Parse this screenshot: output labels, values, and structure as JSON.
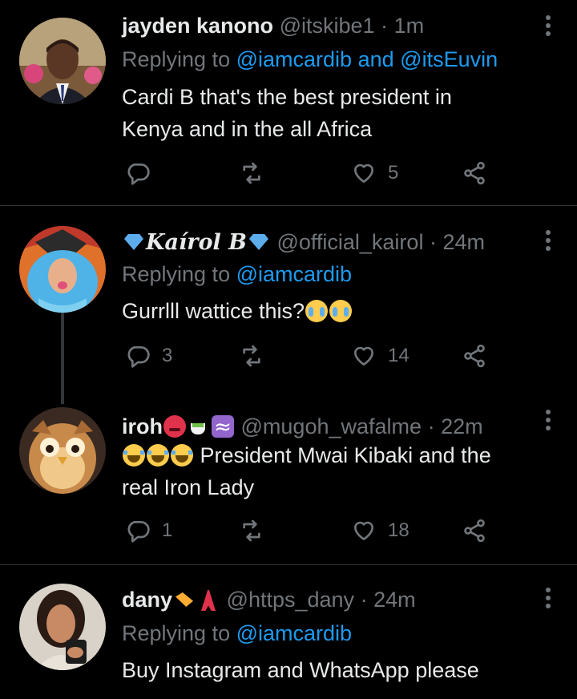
{
  "colors": {
    "background": "#000000",
    "primary_text": "#e7e9ea",
    "secondary_text": "#71767b",
    "accent": "#1d9bf0",
    "divider": "#2f3336"
  },
  "tweets": [
    {
      "name": "jayden kanono",
      "handle": "@itskibe1",
      "separator": "·",
      "time": "1m",
      "replying_prefix": "Replying to",
      "mention1": "@iamcardib",
      "mention_join": "and",
      "mention2": "@itsEuvin",
      "text_line1": "Cardi B that's the best president in",
      "text_line2": "Kenya and in the all Africa",
      "reply_count": "",
      "retweet_count": "",
      "like_count": "5",
      "avatar_icon": "avatar-man-suit"
    },
    {
      "name": "Kaírol B",
      "handle": "@official_kairol",
      "separator": "·",
      "time": "24m",
      "replying_prefix": "Replying to",
      "mention1": "@iamcardib",
      "text_line1": "Gurrlll wattice this?",
      "reply_count": "3",
      "retweet_count": "",
      "like_count": "14",
      "avatar_icon": "avatar-blue-hair"
    },
    {
      "name": "iroh",
      "handle": "@mugoh_wafalme",
      "separator": "·",
      "time": "22m",
      "text_line1_suffix": "President Mwai Kibaki and the",
      "text_line2": "real Iron Lady",
      "reply_count": "1",
      "retweet_count": "",
      "like_count": "18",
      "avatar_icon": "avatar-owl"
    },
    {
      "name": "dany",
      "handle": "@https_dany",
      "separator": "·",
      "time": "24m",
      "replying_prefix": "Replying to",
      "mention1": "@iamcardib",
      "text_line1": "Buy Instagram and WhatsApp please",
      "avatar_icon": "avatar-woman-selfie"
    }
  ]
}
